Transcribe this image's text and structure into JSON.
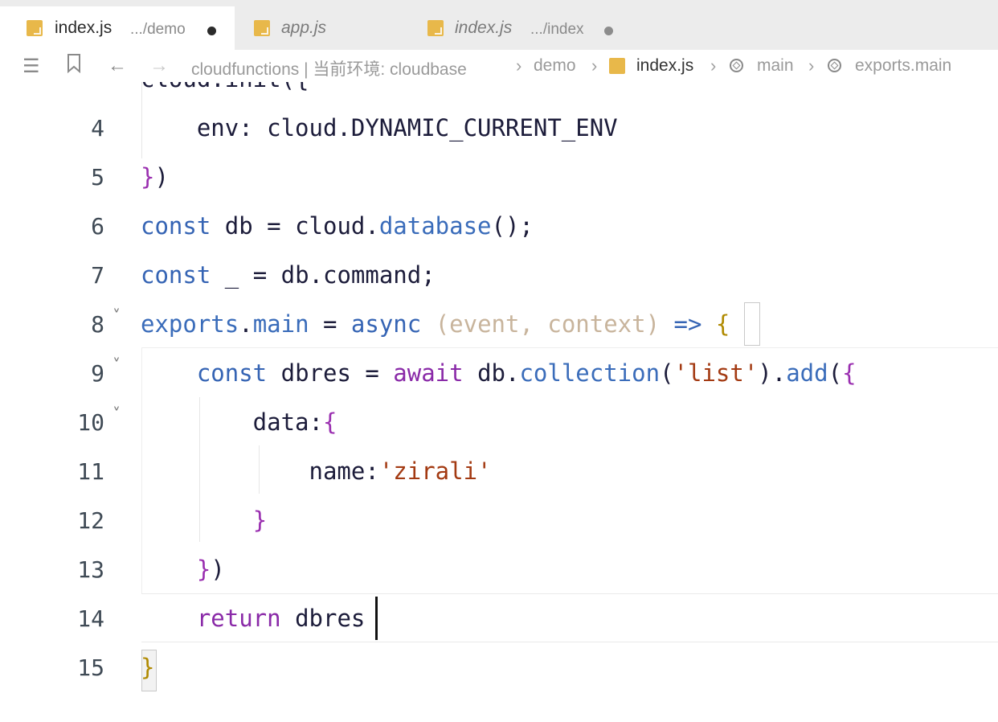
{
  "tabs": [
    {
      "name": "index.js",
      "desc": ".../demo",
      "active": true,
      "modified": true
    },
    {
      "name": "app.js",
      "desc": "",
      "active": false,
      "modified": false
    },
    {
      "name": "index.js",
      "desc": ".../index",
      "active": false,
      "modified": true
    }
  ],
  "breadcrumb": {
    "path": "cloudfunctions | 当前环境: cloudbase",
    "items": [
      "demo",
      "index.js",
      "main",
      "exports.main"
    ]
  },
  "editor": {
    "partial_line_top": "cloud.init({",
    "line_numbers": [
      "4",
      "5",
      "6",
      "7",
      "8",
      "9",
      "10",
      "11",
      "12",
      "13",
      "14",
      "15"
    ]
  },
  "colors": {
    "keyword": "#3564b4",
    "control_keyword": "#8a2aa8",
    "string": "#a33a12",
    "parameter": "#c8b49c",
    "file_icon": "#e8b84a"
  }
}
